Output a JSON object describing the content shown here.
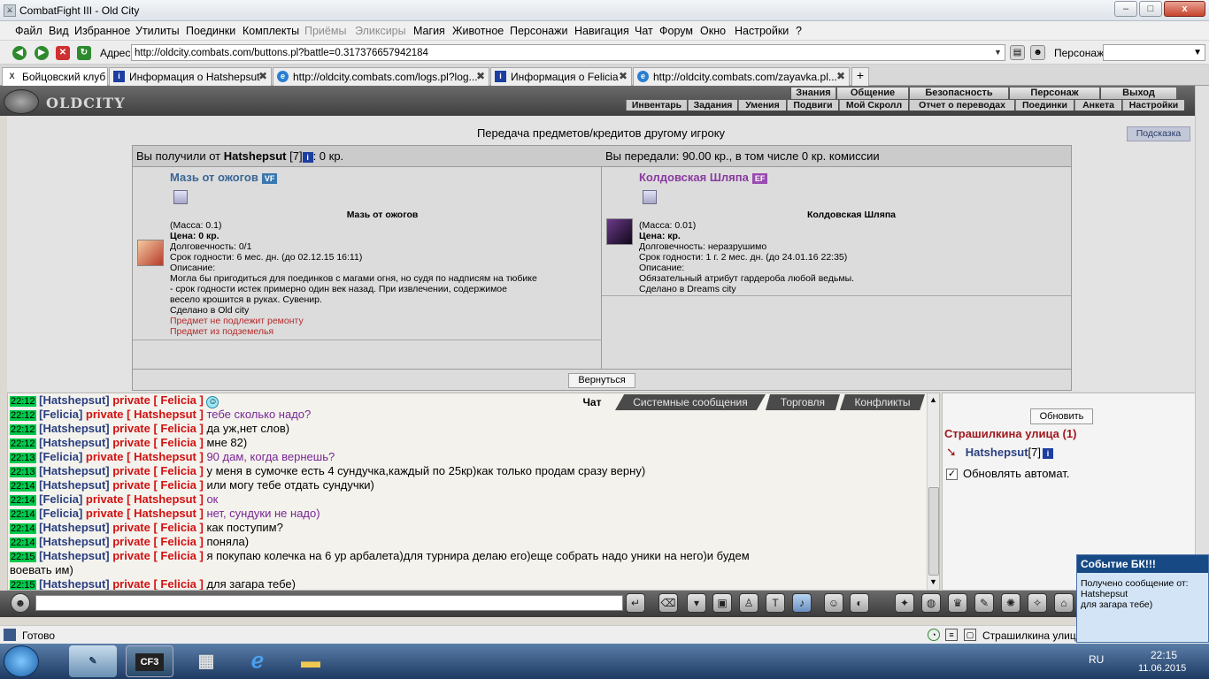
{
  "window": {
    "title": "CombatFight III - Old City",
    "min": "–",
    "max": "□",
    "close": "x"
  },
  "menu": [
    "Файл",
    "Вид",
    "Избранное",
    "Утилиты",
    "Поединки",
    "Комплекты",
    "Приёмы",
    "Эликсиры",
    "Магия",
    "Животное",
    "Персонажи",
    "Навигация",
    "Чат",
    "Форум",
    "Окно",
    "Настройки",
    "?"
  ],
  "address": {
    "label": "Адрес:",
    "url": "http://oldcity.combats.com/buttons.pl?battle=0.317376657942184",
    "persona_label": "Персонаж:"
  },
  "tabs": [
    {
      "label": "Бойцовский клуб",
      "icon": "X"
    },
    {
      "label": "Информация о Hatshepsut",
      "icon": "i"
    },
    {
      "label": "http://oldcity.combats.com/logs.pl?log...",
      "icon": "e"
    },
    {
      "label": "Информация о Felicia",
      "icon": "i"
    },
    {
      "label": "http://oldcity.combats.com/zayavka.pl...",
      "icon": "e"
    }
  ],
  "tab_close": "✖",
  "new_tab": "+",
  "logo": "OLDCITY",
  "topnav": [
    "Знания",
    "Общение",
    "Безопасность",
    "Персонаж",
    "Выход"
  ],
  "subnav": [
    "Инвентарь",
    "Задания",
    "Умения",
    "Подвиги",
    "Мой Скролл",
    "Отчет о переводах",
    "Поединки",
    "Анкета",
    "Настройки"
  ],
  "trade": {
    "title": "Передача предметов/кредитов другому игроку",
    "hint": "Подсказка",
    "left": {
      "head_pre": "Вы получили от ",
      "head_user": "Hatshepsut",
      "head_level": " [7]",
      "head_post": ": 0 кр.",
      "item_name": "Мазь от ожогов",
      "badge": "VF",
      "center_name": "Мазь от ожогов",
      "lines": [
        "(Масса: 0.1)",
        "Цена: 0 кр.",
        "Долговечность: 0/1",
        "Срок годности: 6 мес. дн. (до 02.12.15 16:11)",
        "Описание:",
        "Могла бы пригодиться для поединков с магами огня, но судя по надписям на тюбике",
        "- срок годности истек примерно один век назад. При извлечении, содержимое",
        "весело крошится в руках. Сувенир.",
        "Сделано в Old city"
      ],
      "red_lines": [
        "Предмет не подлежит ремонту",
        "Предмет из подземелья"
      ]
    },
    "right": {
      "head": "Вы передали: 90.00 кр., в том числе 0 кр. комиссии",
      "item_name": "Колдовская Шляпа",
      "badge": "EF",
      "center_name": "Колдовская Шляпа",
      "lines": [
        "(Масса: 0.01)",
        "Цена: кр.",
        "Долговечность: неразрушимо",
        "Срок годности: 1 г. 2 мес. дн. (до 24.01.16 22:35)",
        "Описание:",
        "Обязательный атрибут гардероба любой ведьмы.",
        "Сделано в Dreams city"
      ]
    },
    "back": "Вернуться"
  },
  "chat": {
    "tabs": [
      "Чат",
      "Системные сообщения",
      "Торговля",
      "Конфликты"
    ],
    "messages": [
      {
        "time": "22:12",
        "from": "[Hatshepsut]",
        "priv": "private [ Felicia ]",
        "text": "",
        "own": false,
        "smile": true
      },
      {
        "time": "22:12",
        "from": "[Felicia]",
        "priv": "private [ Hatshepsut ]",
        "text": "тебе сколько надо?",
        "own": true
      },
      {
        "time": "22:12",
        "from": "[Hatshepsut]",
        "priv": "private [ Felicia ]",
        "text": "да уж,нет слов)",
        "own": false
      },
      {
        "time": "22:12",
        "from": "[Hatshepsut]",
        "priv": "private [ Felicia ]",
        "text": "мне 82)",
        "own": false
      },
      {
        "time": "22:13",
        "from": "[Felicia]",
        "priv": "private [ Hatshepsut ]",
        "text": "90 дам, когда вернешь?",
        "own": true
      },
      {
        "time": "22:13",
        "from": "[Hatshepsut]",
        "priv": "private [ Felicia ]",
        "text": "у меня в сумочке есть 4 сундучка,каждый по 25кр)как только продам сразу верну)",
        "own": false
      },
      {
        "time": "22:14",
        "from": "[Hatshepsut]",
        "priv": "private [ Felicia ]",
        "text": "или могу тебе отдать сундучки)",
        "own": false
      },
      {
        "time": "22:14",
        "from": "[Felicia]",
        "priv": "private [ Hatshepsut ]",
        "text": "ок",
        "own": true
      },
      {
        "time": "22:14",
        "from": "[Felicia]",
        "priv": "private [ Hatshepsut ]",
        "text": "нет, сундуки не надо)",
        "own": true
      },
      {
        "time": "22:14",
        "from": "[Hatshepsut]",
        "priv": "private [ Felicia ]",
        "text": "как поступим?",
        "own": false
      },
      {
        "time": "22:14",
        "from": "[Hatshepsut]",
        "priv": "private [ Felicia ]",
        "text": "поняла)",
        "own": false
      },
      {
        "time": "22:15",
        "from": "[Hatshepsut]",
        "priv": "private [ Felicia ]",
        "text": "я покупаю колечка на 6 ур арбалета)для турнира делаю его)еще собрать надо уники на него)и будем",
        "own": false
      },
      {
        "time": "",
        "from": "",
        "priv": "",
        "text": "воевать им)",
        "own": false,
        "cont": true
      },
      {
        "time": "22:15",
        "from": "[Hatshepsut]",
        "priv": "private [ Felicia ]",
        "text": "для загара тебе)",
        "own": false
      }
    ]
  },
  "side": {
    "refresh": "Обновить",
    "location": "Страшилкина улица (1)",
    "user": "Hatshepsut",
    "user_level": "[7]",
    "auto": "Обновлять автомат."
  },
  "status": {
    "text": "Готово",
    "location": "Страшилкина улица"
  },
  "popup": {
    "title": "Событие БК!!!",
    "line1": "Получено сообщение от:",
    "line2": "Hatshepsut",
    "line3": "для загара тебе)"
  },
  "taskbar": {
    "lang": "RU",
    "time": "22:15",
    "date": "11.06.2015",
    "cf_label": "CF3"
  }
}
